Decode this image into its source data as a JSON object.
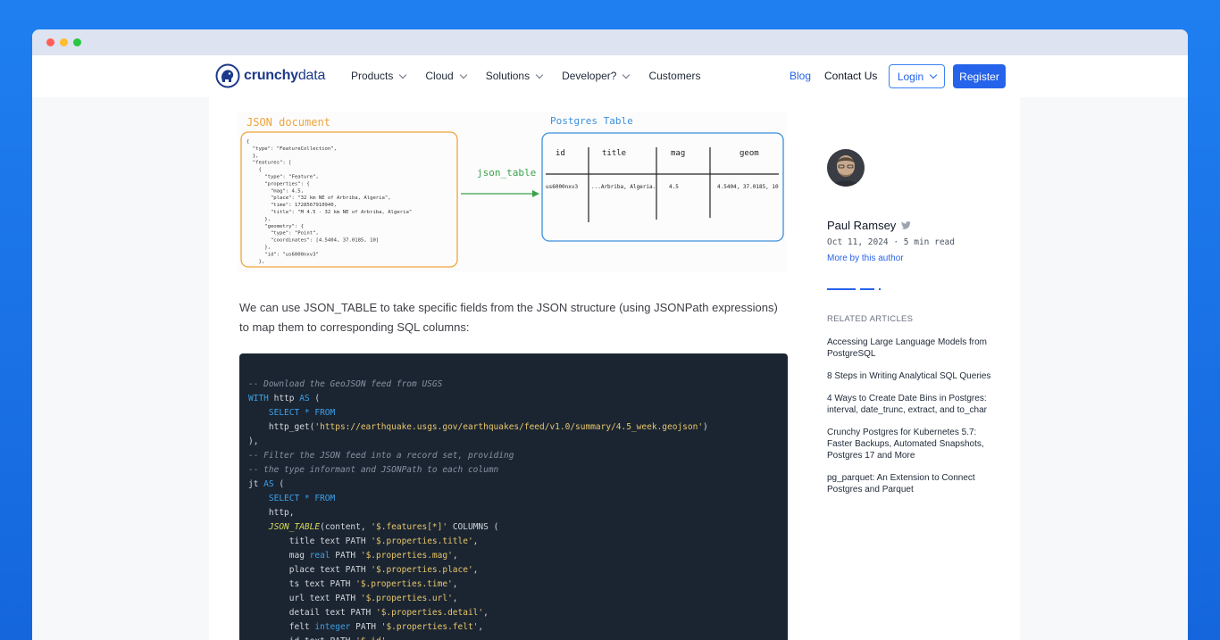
{
  "nav": {
    "logo_primary": "crunchy",
    "logo_secondary": "data",
    "products": "Products",
    "cloud": "Cloud",
    "solutions": "Solutions",
    "developer": "Developer?",
    "customers": "Customers",
    "blog": "Blog",
    "contact": "Contact Us",
    "login": "Login",
    "register": "Register"
  },
  "diagram": {
    "json_title": "JSON document",
    "arrow_label": "json_table",
    "table_title": "Postgres Table",
    "json_lines": [
      "{",
      "  \"type\": \"FeatureCollection\",",
      "  },",
      "  \"features\": [",
      "    {",
      "      \"type\": \"Feature\",",
      "      \"properties\": {",
      "        \"mag\": 4.5,",
      "        \"place\": \"32 km NE of Arbriba, Algeria\",",
      "        \"time\": 1728567910940,",
      "        \"title\": \"M 4.5 - 32 km NE of Arbriba, Algeria\"",
      "      },",
      "      \"geometry\": {",
      "        \"type\": \"Point\",",
      "        \"coordinates\": [4.5404, 37.0185, 10]",
      "      },",
      "      \"id\": \"us6000nxv3\"",
      "    },"
    ],
    "columns": [
      "id",
      "title",
      "mag",
      "geom"
    ],
    "row": [
      "us6000nxv3",
      "...Arbriba, Algeria.",
      "4.5",
      "4.5404, 37.0185, 10"
    ]
  },
  "article": {
    "paragraph": "We can use JSON_TABLE to take specific fields from the JSON structure (using JSONPath expressions) to map them to corresponding SQL columns:"
  },
  "code": [
    [
      [
        "c-com",
        "-- Download the GeoJSON feed from USGS"
      ]
    ],
    [
      [
        "c-kw",
        "WITH"
      ],
      [
        "",
        " http "
      ],
      [
        "c-kw",
        "AS"
      ],
      [
        "",
        " ("
      ]
    ],
    [
      [
        "",
        "    "
      ],
      [
        "c-kw",
        "SELECT * FROM"
      ]
    ],
    [
      [
        "",
        "    http_get("
      ],
      [
        "c-str",
        "'https://earthquake.usgs.gov/earthquakes/feed/v1.0/summary/4.5_week.geojson'"
      ],
      [
        "",
        ")"
      ]
    ],
    [
      [
        "",
        "),"
      ]
    ],
    [
      [
        "c-com",
        "-- Filter the JSON feed into a record set, providing"
      ]
    ],
    [
      [
        "c-com",
        "-- the type informant and JSONPath to each column"
      ]
    ],
    [
      [
        "",
        "jt "
      ],
      [
        "c-kw",
        "AS"
      ],
      [
        "",
        " ("
      ]
    ],
    [
      [
        "",
        "    "
      ],
      [
        "c-kw",
        "SELECT * FROM"
      ]
    ],
    [
      [
        "",
        "    http,"
      ]
    ],
    [
      [
        "",
        "    "
      ],
      [
        "c-fn",
        "JSON_TABLE"
      ],
      [
        "",
        "(content, "
      ],
      [
        "c-str",
        "'$.features[*]'"
      ],
      [
        "",
        " COLUMNS ("
      ]
    ],
    [
      [
        "",
        "        title text PATH "
      ],
      [
        "c-str",
        "'$.properties.title'"
      ],
      [
        "",
        ","
      ]
    ],
    [
      [
        "",
        "        mag "
      ],
      [
        "c-kw",
        "real"
      ],
      [
        "",
        " PATH "
      ],
      [
        "c-str",
        "'$.properties.mag'"
      ],
      [
        "",
        ","
      ]
    ],
    [
      [
        "",
        "        place text PATH "
      ],
      [
        "c-str",
        "'$.properties.place'"
      ],
      [
        "",
        ","
      ]
    ],
    [
      [
        "",
        "        ts text PATH "
      ],
      [
        "c-str",
        "'$.properties.time'"
      ],
      [
        "",
        ","
      ]
    ],
    [
      [
        "",
        "        url text PATH "
      ],
      [
        "c-str",
        "'$.properties.url'"
      ],
      [
        "",
        ","
      ]
    ],
    [
      [
        "",
        "        detail text PATH "
      ],
      [
        "c-str",
        "'$.properties.detail'"
      ],
      [
        "",
        ","
      ]
    ],
    [
      [
        "",
        "        felt "
      ],
      [
        "c-kw",
        "integer"
      ],
      [
        "",
        " PATH "
      ],
      [
        "c-str",
        "'$.properties.felt'"
      ],
      [
        "",
        ","
      ]
    ],
    [
      [
        "",
        "        id text PATH "
      ],
      [
        "c-str",
        "'$.id'"
      ],
      [
        "",
        ","
      ]
    ]
  ],
  "author": {
    "name": "Paul Ramsey",
    "twitter_icon": "twitter-icon",
    "meta": "Oct 11, 2024 · 5 min read",
    "more_link": "More by this author"
  },
  "related": {
    "title": "RELATED ARTICLES",
    "items": [
      "Accessing Large Language Models from PostgreSQL",
      "8 Steps in Writing Analytical SQL Queries",
      "4 Ways to Create Date Bins in Postgres: interval, date_trunc, extract, and to_char",
      "Crunchy Postgres for Kubernetes 5.7: Faster Backups, Automated Snapshots, Postgres 17 and More",
      "pg_parquet: An Extension to Connect Postgres and Parquet"
    ]
  },
  "colors": {
    "accent": "#2563eb",
    "json_box": "#f0a43a",
    "table_box": "#3b8fdc",
    "arrow": "#3aa34a",
    "code_bg": "#1b2532"
  }
}
